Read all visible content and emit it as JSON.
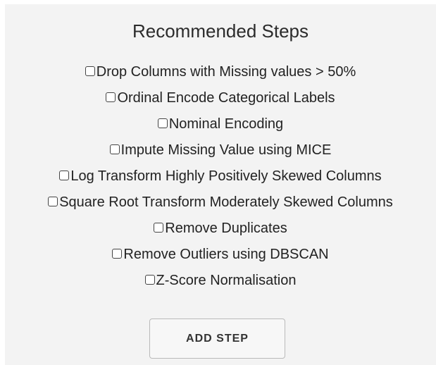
{
  "panel": {
    "title": "Recommended Steps",
    "steps": [
      {
        "label": "Drop Columns with Missing values > 50%",
        "checked": false
      },
      {
        "label": "Ordinal Encode Categorical Labels",
        "checked": false
      },
      {
        "label": "Nominal Encoding",
        "checked": false
      },
      {
        "label": "Impute Missing Value using MICE",
        "checked": false
      },
      {
        "label": "Log Transform Highly Positively Skewed Columns",
        "checked": false
      },
      {
        "label": "Square Root Transform Moderately Skewed Columns",
        "checked": false
      },
      {
        "label": "Remove Duplicates",
        "checked": false
      },
      {
        "label": "Remove Outliers using DBSCAN",
        "checked": false
      },
      {
        "label": "Z-Score Normalisation",
        "checked": false
      }
    ],
    "add_button_label": "ADD STEP"
  }
}
